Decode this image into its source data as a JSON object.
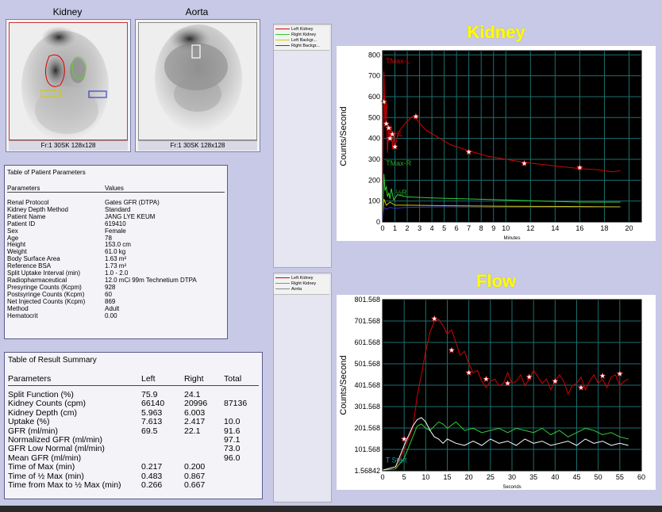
{
  "images": [
    {
      "title": "Kidney",
      "caption": "Fr:1 30SK 128x128"
    },
    {
      "title": "Aorta",
      "caption": "Fr:1 30SK 128x128"
    }
  ],
  "patient_table": {
    "title": "Table of Patient Parameters",
    "col1": "Parameters",
    "col2": "Values",
    "rows": [
      {
        "label": "Renal Protocol",
        "value": "Gates GFR (DTPA)"
      },
      {
        "label": "Kidney Depth Method",
        "value": "Standard"
      },
      {
        "label": "Patient Name",
        "value": "JANG LYE KEUM"
      },
      {
        "label": "Patient ID",
        "value": "619410"
      },
      {
        "label": "Sex",
        "value": "Female"
      },
      {
        "label": "Age",
        "value": "78"
      },
      {
        "label": "Height",
        "value": "153.0 cm"
      },
      {
        "label": "Weight",
        "value": "61.0 kg"
      },
      {
        "label": "Body Surface Area",
        "value": "1.63 m²"
      },
      {
        "label": "Reference BSA",
        "value": "1.73 m²"
      },
      {
        "label": "Split Uptake Interval (min)",
        "value": "1.0 - 2.0"
      },
      {
        "label": "Radiopharmaceutical",
        "value": "12.0 mCi 99m Technetium DTPA"
      },
      {
        "label": "Presyringe Counts (Kcpm)",
        "value": "928"
      },
      {
        "label": "Postsyringe Counts (Kcpm)",
        "value": "60"
      },
      {
        "label": "Net Injected Counts (Kcpm)",
        "value": "869"
      },
      {
        "label": "Method",
        "value": "Adult"
      },
      {
        "label": "Hematocrit",
        "value": "0.00"
      }
    ]
  },
  "result_table": {
    "title": "Table of Result Summary",
    "headers": [
      "Parameters",
      "Left",
      "Right",
      "Total"
    ],
    "rows": [
      [
        "Split Function (%)",
        "75.9",
        "24.1",
        ""
      ],
      [
        "Kidney Counts (cpm)",
        "66140",
        "20996",
        "87136"
      ],
      [
        "Kidney Depth (cm)",
        "5.963",
        "6.003",
        ""
      ],
      [
        "Uptake (%)",
        "7.613",
        "2.417",
        "10.0"
      ],
      [
        "GFR (ml/min)",
        "69.5",
        "22.1",
        "91.6"
      ],
      [
        "Normalized GFR (ml/min)",
        "",
        "",
        "97.1"
      ],
      [
        "GFR Low Normal (ml/min)",
        "",
        "",
        "73.0"
      ],
      [
        "Mean GFR (ml/min)",
        "",
        "",
        "96.0"
      ],
      [
        "Time of Max (min)",
        "0.217",
        "0.200",
        ""
      ],
      [
        "Time of ½ Max (min)",
        "0.483",
        "0.867",
        ""
      ],
      [
        "Time from Max to ½ Max (min)",
        "0.266",
        "0.667",
        ""
      ]
    ]
  },
  "legend_kidney": [
    {
      "label": "Left Kidney",
      "color": "#d40000"
    },
    {
      "label": "Right Kidney",
      "color": "#33cc33"
    },
    {
      "label": "Left Backgr...",
      "color": "#cccc00"
    },
    {
      "label": "Right Backgr...",
      "color": "#3333cc"
    }
  ],
  "legend_flow": [
    {
      "label": "Left Kidney",
      "color": "#d40000"
    },
    {
      "label": "Right Kidney",
      "color": "#33cc33"
    },
    {
      "label": "Aorta",
      "color": "#ffffff"
    }
  ],
  "chart_data": [
    {
      "type": "line",
      "title": "Kidney",
      "xlabel": "Minutes",
      "ylabel": "Counts/Second",
      "xlim": [
        0,
        21
      ],
      "ylim": [
        0,
        820
      ],
      "xticks": [
        "0",
        "1",
        "2",
        "3",
        "4",
        "5",
        "6",
        "7",
        "8",
        "9",
        "10",
        "12",
        "14",
        "16",
        "18",
        "20"
      ],
      "xtick_values": [
        0,
        1,
        2,
        3,
        4,
        5,
        6,
        7,
        8,
        9,
        10,
        12,
        14,
        16,
        18,
        20
      ],
      "yticks": [
        0,
        100,
        200,
        300,
        400,
        500,
        600,
        700,
        800
      ],
      "annotations": [
        {
          "text": "TMax-L",
          "x": 0.2,
          "y": 760,
          "color": "#d40000"
        },
        {
          "text": "TMax-R",
          "x": 0.2,
          "y": 270,
          "color": "#22aa22"
        },
        {
          "text": "½L",
          "x": 0.8,
          "y": 410,
          "color": "#d40000"
        },
        {
          "text": "½R",
          "x": 1.0,
          "y": 130,
          "color": "#22aa22"
        }
      ],
      "grid": true,
      "series": [
        {
          "name": "Left Kidney",
          "color": "#d40000",
          "x": [
            0,
            0.1,
            0.2,
            0.3,
            0.4,
            0.5,
            0.6,
            0.7,
            0.8,
            0.9,
            1.0,
            1.3,
            1.8,
            2.4,
            2.7,
            3.5,
            4.5,
            5.5,
            7.0,
            8.5,
            10,
            11.5,
            13,
            14.5,
            16,
            17.5,
            18.6,
            19.3
          ],
          "y": [
            0,
            720,
            470,
            575,
            330,
            450,
            400,
            460,
            350,
            420,
            360,
            430,
            470,
            505,
            495,
            440,
            405,
            370,
            340,
            315,
            300,
            285,
            275,
            265,
            255,
            250,
            240,
            245
          ],
          "markers_x": [
            0.1,
            0.3,
            0.5,
            0.6,
            0.8,
            1.0,
            2.7,
            7.0,
            11.5,
            16.0
          ],
          "markers_y": [
            575,
            470,
            450,
            400,
            420,
            360,
            505,
            335,
            280,
            260
          ]
        },
        {
          "name": "Right Kidney",
          "color": "#33cc33",
          "x": [
            0,
            0.1,
            0.2,
            0.3,
            0.4,
            0.5,
            0.6,
            0.7,
            0.9,
            1.2,
            2,
            4,
            7,
            10,
            13,
            16,
            19.3
          ],
          "y": [
            0,
            230,
            150,
            170,
            120,
            140,
            110,
            160,
            105,
            130,
            120,
            115,
            110,
            105,
            100,
            95,
            95
          ]
        },
        {
          "name": "Left Backgr...",
          "color": "#cccc00",
          "x": [
            0,
            0.1,
            0.3,
            0.6,
            1,
            2,
            5,
            10,
            15,
            19.3
          ],
          "y": [
            0,
            110,
            80,
            95,
            80,
            80,
            78,
            75,
            74,
            72
          ]
        },
        {
          "name": "Right Backgr...",
          "color": "#3333cc",
          "x": [
            0,
            0.1,
            0.3,
            0.6,
            1,
            2,
            5,
            10,
            15,
            19.3
          ],
          "y": [
            0,
            70,
            60,
            70,
            65,
            70,
            72,
            70,
            70,
            70
          ]
        }
      ]
    },
    {
      "type": "line",
      "title": "Flow",
      "xlabel": "Seconds",
      "ylabel": "Counts/Second",
      "xlim": [
        0,
        60
      ],
      "ylim": [
        1.56842,
        801.568
      ],
      "xticks": [
        "0",
        "5",
        "10",
        "15",
        "20",
        "25",
        "30",
        "35",
        "40",
        "45",
        "50",
        "55",
        "60"
      ],
      "xtick_values": [
        0,
        5,
        10,
        15,
        20,
        25,
        30,
        35,
        40,
        45,
        50,
        55,
        60
      ],
      "yticks": [
        "1.56842",
        "101.568",
        "201.568",
        "301.568",
        "401.568",
        "501.568",
        "601.568",
        "701.568",
        "801.568"
      ],
      "ytick_values": [
        1.56842,
        101.568,
        201.568,
        301.568,
        401.568,
        501.568,
        601.568,
        701.568,
        801.568
      ],
      "annotations": [
        {
          "text": "T Start",
          "x": 0.5,
          "y": 40,
          "color": "#00aaaa"
        }
      ],
      "grid": true,
      "series": [
        {
          "name": "Left Kidney",
          "color": "#d40000",
          "x": [
            0,
            3,
            5,
            7,
            8,
            9,
            10,
            11,
            12,
            13,
            14,
            15,
            16,
            17,
            18,
            19,
            20,
            21,
            22,
            23,
            24,
            25,
            26,
            27,
            28,
            29,
            30,
            31,
            32,
            33,
            34,
            35,
            36,
            37,
            38,
            39,
            40,
            41,
            42,
            43,
            44,
            45,
            46,
            47,
            48,
            49,
            50,
            51,
            52,
            53,
            54,
            55,
            56,
            57
          ],
          "y": [
            5,
            10,
            100,
            200,
            350,
            450,
            560,
            650,
            700,
            710,
            680,
            640,
            660,
            600,
            540,
            560,
            500,
            460,
            470,
            420,
            390,
            420,
            430,
            400,
            410,
            460,
            410,
            420,
            450,
            400,
            430,
            470,
            440,
            410,
            430,
            380,
            420,
            450,
            420,
            360,
            400,
            410,
            440,
            380,
            420,
            450,
            410,
            430,
            390,
            440,
            450,
            400,
            420,
            430
          ],
          "markers_x": [
            5,
            12,
            16,
            20,
            24,
            29,
            34,
            40,
            46,
            51,
            55
          ],
          "markers_y": [
            150,
            712,
            565,
            460,
            430,
            410,
            440,
            420,
            390,
            445,
            455
          ]
        },
        {
          "name": "Right Kidney",
          "color": "#33cc33",
          "x": [
            0,
            3,
            5,
            7,
            8,
            9,
            10,
            11,
            12,
            13,
            14,
            15,
            17,
            19,
            21,
            23,
            25,
            27,
            29,
            31,
            33,
            35,
            37,
            39,
            41,
            43,
            45,
            47,
            49,
            51,
            53,
            55,
            57
          ],
          "y": [
            5,
            10,
            60,
            160,
            210,
            220,
            200,
            190,
            210,
            230,
            220,
            200,
            230,
            190,
            200,
            180,
            190,
            200,
            180,
            200,
            190,
            180,
            200,
            170,
            190,
            160,
            180,
            200,
            190,
            170,
            180,
            160,
            150
          ]
        },
        {
          "name": "Aorta",
          "color": "#ffffff",
          "x": [
            0,
            3,
            5,
            7,
            8,
            9,
            10,
            11,
            12,
            13,
            14,
            15,
            17,
            19,
            21,
            23,
            25,
            27,
            29,
            31,
            33,
            35,
            37,
            39,
            41,
            43,
            45,
            47,
            49,
            51,
            53,
            55,
            57
          ],
          "y": [
            5,
            20,
            120,
            210,
            240,
            250,
            230,
            190,
            160,
            150,
            130,
            150,
            130,
            120,
            140,
            120,
            150,
            130,
            140,
            120,
            150,
            130,
            140,
            120,
            130,
            140,
            120,
            150,
            130,
            140,
            120,
            130,
            120
          ]
        }
      ]
    }
  ]
}
